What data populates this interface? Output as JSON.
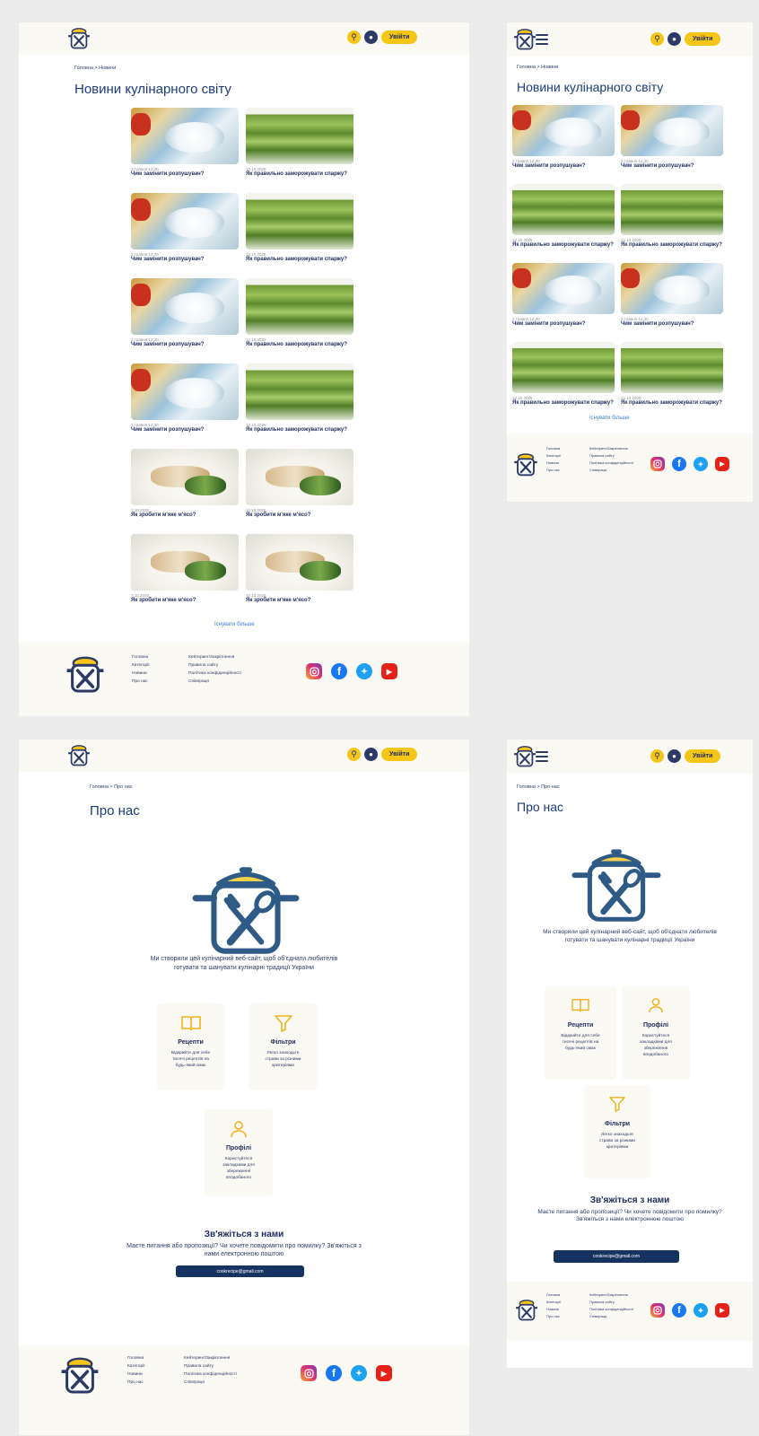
{
  "header": {
    "login": "Увійти",
    "search_icon": "search-icon",
    "user_icon": "user-icon"
  },
  "news": {
    "breadcrumb": "Головна > Новини",
    "title": "Новини кулінарного світу",
    "more": "Існувати більше"
  },
  "news_mobile": {
    "breadcrumb": "Головна > Новини",
    "title": "Новини кулінарного світу",
    "more": "Існувати більше"
  },
  "articles": [
    {
      "date": "2 травня 12:30",
      "title": "Чим замінити розпушувач?"
    },
    {
      "date": "12.10.2025",
      "title": "Як правильно заморожувати спаржу?"
    },
    {
      "date": "3 травня 12:30",
      "title": "Чим замінити розпушувач?"
    },
    {
      "date": "12.10.2025",
      "title": "Як правильно заморожувати спаржу?"
    },
    {
      "date": "2 травня 12:30",
      "title": "Чим замінити розпушувач?"
    },
    {
      "date": "12.10.2025",
      "title": "Як правильно заморожувати спаржу?"
    },
    {
      "date": "2 травня 12:30",
      "title": "Чим замінити розпушувач?"
    },
    {
      "date": "12.10.2025",
      "title": "Як правильно заморожувати спаржу?"
    },
    {
      "date": "7.10.2025",
      "title": "Як зробити м'яке м'ясо?"
    },
    {
      "date": "10.10.2025",
      "title": "Як зробити м'яке м'ясо?"
    },
    {
      "date": "7.10.2025",
      "title": "Як зробити м'яке м'ясо?"
    },
    {
      "date": "10.10.2025",
      "title": "Як зробити м'яке м'ясо?"
    }
  ],
  "articles_mobile": [
    {
      "date": "2 травня 12:30",
      "title": "Чим замінити розпушувач?"
    },
    {
      "date": "2 травня 12:30",
      "title": "Чим замінити розпушувач?"
    },
    {
      "date": "12.10.2025",
      "title": "Як правильно заморожувати спаржу?"
    },
    {
      "date": "12.10.2025",
      "title": "Як правильно заморожувати спаржу?"
    },
    {
      "date": "2 травня 12:30",
      "title": "Чим замінити розпушувач?"
    },
    {
      "date": "2 травня 12:30",
      "title": "Чим замінити розпушувач?"
    },
    {
      "date": "12.10.2025",
      "title": "Як правильно заморожувати спаржу?"
    },
    {
      "date": "12.10.2025",
      "title": "Як правильно заморожувати спаржу?"
    }
  ],
  "footer": {
    "col1": [
      "Головна",
      "Категорії",
      "Новини",
      "Про нас"
    ],
    "col2": [
      "Кейтеринг/Закріплення",
      "Правила сайту",
      "Політика конфіденційності",
      "Співпраця"
    ]
  },
  "about": {
    "breadcrumb": "Головна > Про нас",
    "title": "Про нас",
    "text": "Ми створили цей кулінарний веб-сайт, щоб об'єднати любителів готувати та шанувати кулінарні традиції України",
    "features": [
      {
        "title": "Рецепти",
        "desc": "Відкрийте для себе тисячі рецептів на будь-який смак",
        "icon": "book-icon"
      },
      {
        "title": "Фільтри",
        "desc": "Легко знаходьте страви за різними критеріями",
        "icon": "filter-icon"
      },
      {
        "title": "Профілі",
        "desc": "Користуйтеся закладками для збереження вподобаного",
        "icon": "profile-icon"
      }
    ],
    "contact_title": "Зв'яжіться з нами",
    "contact_text": "Маєте питання або пропозиції? Чи хочете повідомити про помилку? Зв'яжіться з нами електронною поштою",
    "email": "cookrecipe@gmail.com"
  },
  "colors": {
    "accent": "#f5c518",
    "brand": "#1d2a5c",
    "footer_bg": "#faf9f3",
    "link": "#3d7bd6"
  }
}
